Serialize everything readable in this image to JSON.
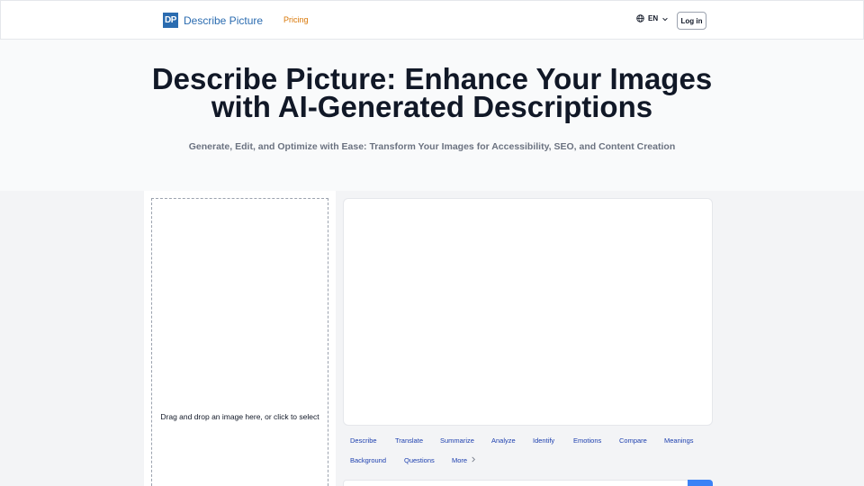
{
  "nav": {
    "logo_mark": "DP",
    "brand": "Describe Picture",
    "pricing": "Pricing",
    "language": "EN",
    "login": "Log in"
  },
  "hero": {
    "title_line1": "Describe Picture: Enhance Your Images",
    "title_line2": "with AI-Generated Descriptions",
    "subtitle": "Generate, Edit, and Optimize with Ease: Transform Your Images for Accessibility, SEO, and Content Creation"
  },
  "upload": {
    "prompt": "Drag and drop an image here, or click to select"
  },
  "actions": {
    "describe": "Describe",
    "translate": "Translate",
    "summarize": "Summarize",
    "analyze": "Analyze",
    "identify": "Identify",
    "emotions": "Emotions",
    "compare": "Compare",
    "meanings": "Meanings",
    "background": "Background",
    "questions": "Questions",
    "more": "More"
  },
  "colors": {
    "brand": "#2b6cb0",
    "pricing": "#d97706",
    "action_link": "#1e40af",
    "submit": "#3b82f6"
  },
  "icons": {
    "language": "globe-icon",
    "language_dropdown": "chevron-down-icon",
    "more": "chevron-right-icon"
  }
}
